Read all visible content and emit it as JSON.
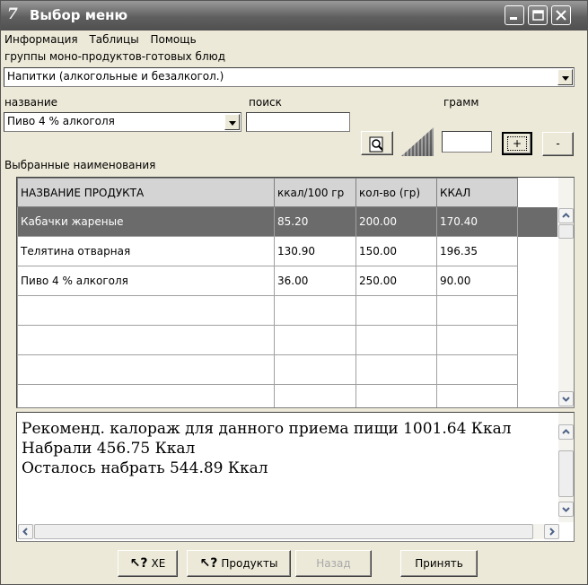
{
  "window": {
    "title": "Выбор меню",
    "app_icon": "7"
  },
  "menu": [
    "Информация",
    "Таблицы",
    "Помощь"
  ],
  "group": {
    "label": "группы моно-продуктов-готовых блюд",
    "value": "Напитки (алкогольные и безалкогол.)"
  },
  "name_field": {
    "label": "название",
    "value": "Пиво  4 % алкоголя"
  },
  "search_field": {
    "label": "поиск",
    "value": ""
  },
  "gram_field": {
    "label": "грамм",
    "value": ""
  },
  "buttons": {
    "plus": "+",
    "minus": "-"
  },
  "selected_label": "Выбранные наименования",
  "table": {
    "columns": [
      "НАЗВАНИЕ ПРОДУКТА",
      "ккал/100 гр",
      "кол-во (гр)",
      "ККАЛ"
    ],
    "rows": [
      [
        "Кабачки жареные",
        "85.20",
        "200.00",
        "170.40"
      ],
      [
        "Телятина отварная",
        "130.90",
        "150.00",
        "196.35"
      ],
      [
        "Пиво  4 % алкоголя",
        "36.00",
        "250.00",
        "90.00"
      ]
    ],
    "selected_row": 0
  },
  "memo": {
    "lines": [
      "Рекоменд. калораж для данного приема пищи 1001.64 Ккал",
      "Набрали 456.75 Ккал",
      "Осталось набрать 544.89 Ккал"
    ]
  },
  "bottom_buttons": {
    "xe": "ХЕ",
    "products": "Продукты",
    "back": "Назад",
    "accept": "Принять"
  }
}
